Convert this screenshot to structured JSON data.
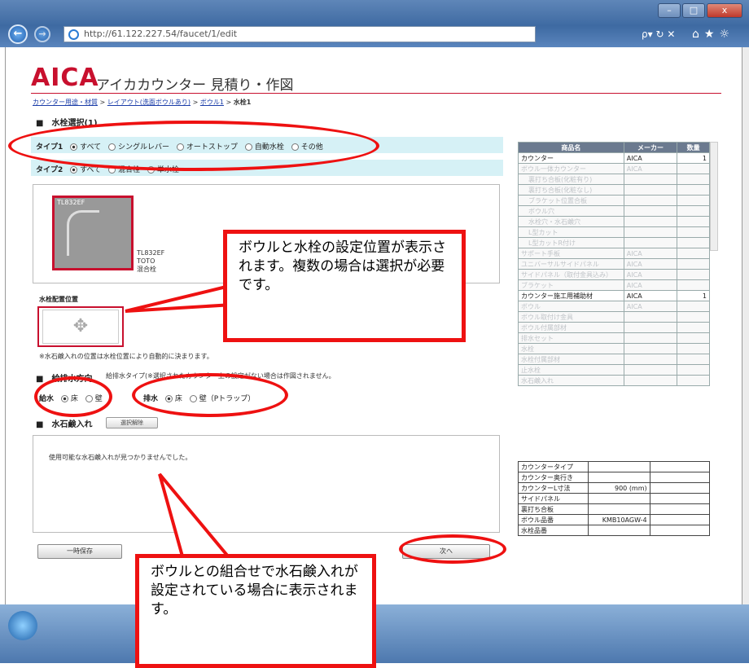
{
  "browser": {
    "url": "http://61.122.227.54/faucet/1/edit",
    "search_icon": "search-icon",
    "window_buttons": [
      "–",
      "□",
      "x"
    ]
  },
  "header": {
    "logo": "AICA",
    "title": "アイカカウンター 見積り・作図"
  },
  "breadcrumb": {
    "items": [
      "カウンター用途・材質",
      "レイアウト(洗面ボウルあり)",
      "ボウル1"
    ],
    "current": "水栓1",
    "separator": ">"
  },
  "faucet_select": {
    "heading": "■　水栓選択(1)",
    "type1_label": "タイプ1",
    "type1_options": [
      "すべて",
      "シングルレバー",
      "オートストップ",
      "自動水栓",
      "その他"
    ],
    "type2_label": "タイプ2",
    "type2_options": [
      "すべて",
      "混合栓",
      "単水栓"
    ]
  },
  "product": {
    "code": "TL832EF",
    "info_code": "TL832EF",
    "maker": "TOTO",
    "kind": "混合栓"
  },
  "placement": {
    "label": "水栓配置位置",
    "note": "※水石鹸入れの位置は水栓位置により自動的に決まります。"
  },
  "water": {
    "heading": "■　給排水方向",
    "note": "給排水タイプ(※選択されたカウンター上の設定がない場合は作図されません。",
    "supply_label": "給水",
    "supply_options": [
      "床",
      "壁"
    ],
    "drain_label": "排水",
    "drain_options": [
      "床",
      "壁（Pトラップ）"
    ]
  },
  "soap": {
    "heading": "■　水石鹸入れ",
    "clear_button": "選択解除",
    "empty_message": "使用可能な水石鹸入れが見つかりませんでした。"
  },
  "buttons": {
    "save": "一時保存",
    "next": "次へ"
  },
  "parts_table": {
    "headers": [
      "商品名",
      "メーカー",
      "数量"
    ],
    "rows": [
      {
        "name": "カウンター",
        "maker": "AICA",
        "qty": "1",
        "active": true
      },
      {
        "name": "ボウル一体カウンター",
        "maker": "AICA",
        "qty": "",
        "active": false
      },
      {
        "name": "裏打ち合板(化粧有り)",
        "maker": "",
        "qty": "",
        "active": false,
        "indent": true
      },
      {
        "name": "裏打ち合板(化粧なし)",
        "maker": "",
        "qty": "",
        "active": false,
        "indent": true
      },
      {
        "name": "ブラケット位置合板",
        "maker": "",
        "qty": "",
        "active": false,
        "indent": true
      },
      {
        "name": "ボウル穴",
        "maker": "",
        "qty": "",
        "active": false,
        "indent": true
      },
      {
        "name": "水栓穴・水石鹸穴",
        "maker": "",
        "qty": "",
        "active": false,
        "indent": true
      },
      {
        "name": "L型カット",
        "maker": "",
        "qty": "",
        "active": false,
        "indent": true
      },
      {
        "name": "L型カットR付け",
        "maker": "",
        "qty": "",
        "active": false,
        "indent": true
      },
      {
        "name": "サポート手板",
        "maker": "AICA",
        "qty": "",
        "active": false
      },
      {
        "name": "ユニバーサルサイドパネル",
        "maker": "AICA",
        "qty": "",
        "active": false
      },
      {
        "name": "サイドパネル（取付金具込み）",
        "maker": "AICA",
        "qty": "",
        "active": false
      },
      {
        "name": "ブラケット",
        "maker": "AICA",
        "qty": "",
        "active": false
      },
      {
        "name": "カウンター施工用補助材",
        "maker": "AICA",
        "qty": "1",
        "active": true
      },
      {
        "name": "ボウル",
        "maker": "AICA",
        "qty": "",
        "active": false
      },
      {
        "name": "ボウル取付け金具",
        "maker": "",
        "qty": "",
        "active": false
      },
      {
        "name": "ボウル付属部材",
        "maker": "",
        "qty": "",
        "active": false
      },
      {
        "name": "排水セット",
        "maker": "",
        "qty": "",
        "active": false
      },
      {
        "name": "水栓",
        "maker": "",
        "qty": "",
        "active": false
      },
      {
        "name": "水栓付属部材",
        "maker": "",
        "qty": "",
        "active": false
      },
      {
        "name": "止水栓",
        "maker": "",
        "qty": "",
        "active": false
      },
      {
        "name": "水石鹸入れ",
        "maker": "",
        "qty": "",
        "active": false
      }
    ]
  },
  "spec_table": {
    "rows": [
      {
        "label": "カウンタータイプ",
        "value": "",
        "extra": ""
      },
      {
        "label": "カウンター奥行き",
        "value": "",
        "extra": ""
      },
      {
        "label": "カウンターL寸法",
        "value": "900 (mm)",
        "extra": ""
      },
      {
        "label": "サイドパネル",
        "value": "",
        "extra": ""
      },
      {
        "label": "裏打ち合板",
        "value": "",
        "extra": ""
      },
      {
        "label": "ボウル品番",
        "value": "KMB10AGW-4",
        "extra": ""
      },
      {
        "label": "水栓品番",
        "value": "",
        "extra": ""
      }
    ]
  },
  "callouts": {
    "placement": "ボウルと水栓の設定位置が表示されます。複数の場合は選択が必要です。",
    "soap": "ボウルとの組合せで水石鹸入れが設定されている場合に表示されます。"
  },
  "annotation_color": "#e11111",
  "brand_color": "#c8102e"
}
